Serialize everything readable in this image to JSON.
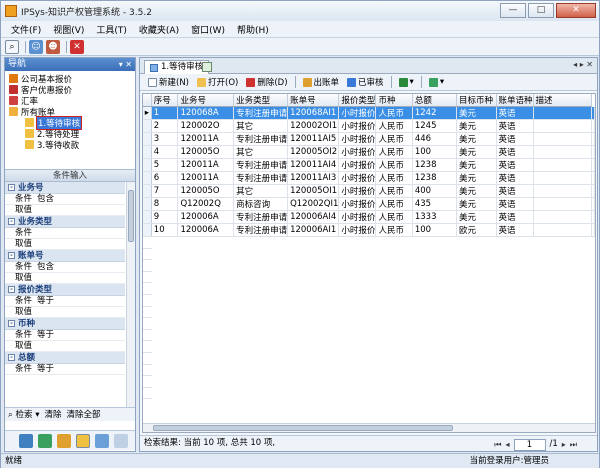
{
  "window": {
    "title": "IPSys-知识产权管理系统 - 3.5.2",
    "min": "—",
    "max": "□",
    "close": "✕"
  },
  "menu": [
    "文件(F)",
    "视图(V)",
    "工具(T)",
    "收藏夹(A)",
    "窗口(W)",
    "帮助(H)"
  ],
  "nav": {
    "title": "导航",
    "header_icons": "▾ ✕",
    "items": [
      {
        "label": "公司基本报价",
        "icon_color": "#e07a10"
      },
      {
        "label": "客户优惠报价",
        "icon_color": "#c03030"
      },
      {
        "label": "汇率",
        "icon_color": "#d04040"
      },
      {
        "label": "所有账单",
        "icon_color": "#f0b040"
      }
    ],
    "sub_items": [
      {
        "label": "1.等待审核",
        "selected": true
      },
      {
        "label": "2.等待处理",
        "selected": false
      },
      {
        "label": "3.等待收款",
        "selected": false
      }
    ]
  },
  "conditions": {
    "title": "条件输入",
    "groups": [
      {
        "title": "业务号",
        "cond_label": "条件",
        "cond_value": "包含",
        "val_label": "取值",
        "val_value": ""
      },
      {
        "title": "业务类型",
        "cond_label": "条件",
        "cond_value": "",
        "val_label": "取值",
        "val_value": ""
      },
      {
        "title": "账单号",
        "cond_label": "条件",
        "cond_value": "包含",
        "val_label": "取值",
        "val_value": ""
      },
      {
        "title": "报价类型",
        "cond_label": "条件",
        "cond_value": "等于",
        "val_label": "取值",
        "val_value": ""
      },
      {
        "title": "币种",
        "cond_label": "条件",
        "cond_value": "等于",
        "val_label": "取值",
        "val_value": ""
      },
      {
        "title": "总额",
        "cond_label": "条件",
        "cond_value": "等于",
        "val_label": "",
        "val_value": ""
      }
    ],
    "search": "检索",
    "search_arrow": "▾",
    "clear": "清除",
    "clear_all": "清除全部"
  },
  "tab": {
    "label": "1.等待审核",
    "ctrls": "◂ ▸ ✕"
  },
  "toolbar": {
    "new": "新建(N)",
    "open": "打开(O)",
    "delete": "删除(D)",
    "bill": "出账单",
    "reviewed": "已审核"
  },
  "table": {
    "columns": [
      "序号",
      "业务号",
      "业务类型",
      "账单号",
      "报价类型",
      "币种",
      "总额",
      "目标币种",
      "账单语种",
      "描述"
    ],
    "rows": [
      [
        "1",
        "120068A",
        "专利注册申请",
        "120068AI1",
        "小时报价",
        "人民币",
        "1242",
        "美元",
        "英语",
        ""
      ],
      [
        "2",
        "120002O",
        "其它",
        "120002OI1",
        "小时报价",
        "人民币",
        "1245",
        "美元",
        "英语",
        ""
      ],
      [
        "3",
        "120011A",
        "专利注册申请",
        "120011AI5",
        "小时报价",
        "人民币",
        "446",
        "美元",
        "英语",
        ""
      ],
      [
        "4",
        "120005O",
        "其它",
        "120005OI2",
        "小时报价",
        "人民币",
        "100",
        "美元",
        "英语",
        ""
      ],
      [
        "5",
        "120011A",
        "专利注册申请",
        "120011AI4",
        "小时报价",
        "人民币",
        "1238",
        "美元",
        "英语",
        ""
      ],
      [
        "6",
        "120011A",
        "专利注册申请",
        "120011AI3",
        "小时报价",
        "人民币",
        "1238",
        "美元",
        "英语",
        ""
      ],
      [
        "7",
        "120005O",
        "其它",
        "120005OI1",
        "小时报价",
        "人民币",
        "400",
        "美元",
        "英语",
        ""
      ],
      [
        "8",
        "Q12002Q",
        "商标咨询",
        "Q12002QI1",
        "小时报价",
        "人民币",
        "435",
        "美元",
        "英语",
        ""
      ],
      [
        "9",
        "120006A",
        "专利注册申请",
        "120006AI4",
        "小时报价",
        "人民币",
        "1333",
        "美元",
        "英语",
        ""
      ],
      [
        "10",
        "120006A",
        "专利注册申请",
        "120006AI1",
        "小时报价",
        "人民币",
        "100",
        "欧元",
        "英语",
        ""
      ]
    ],
    "selected_row": 0,
    "row_pointer": "▸"
  },
  "result": {
    "text": "检索结果: 当前 10 项, 总共 10 项,",
    "page": "1",
    "total_pages": "/1",
    "first": "⏮",
    "prev": "◂",
    "next": "▸",
    "last": "⏭"
  },
  "statusbar": {
    "left": "就绪",
    "right": "当前登录用户:管理员"
  }
}
